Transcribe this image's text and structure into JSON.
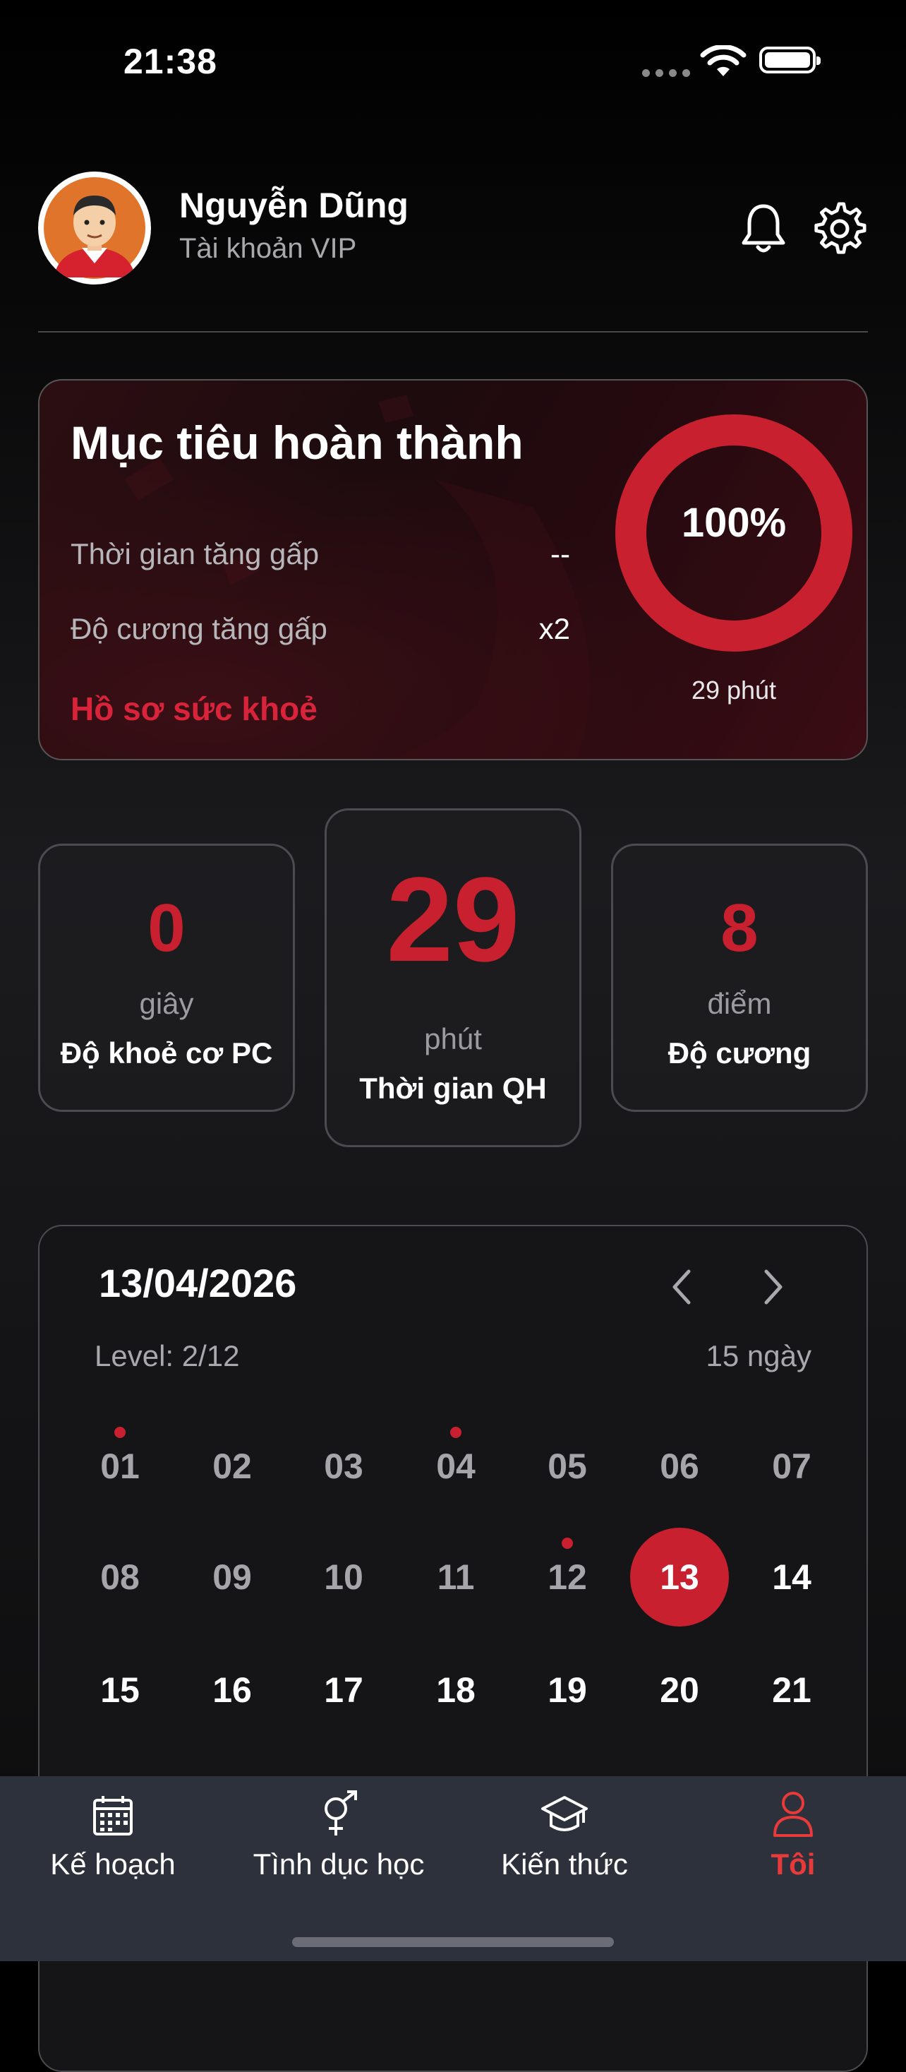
{
  "status_bar": {
    "time": "21:38"
  },
  "profile": {
    "name": "Nguyễn Dũng",
    "subtitle": "Tài khoản VIP",
    "avatar_icon": "avatar-icon",
    "bell_icon": "bell-icon",
    "settings_icon": "gear-icon"
  },
  "goal": {
    "title": "Mục tiêu hoàn thành",
    "rows": [
      {
        "label": "Thời gian tăng gấp",
        "value": "--"
      },
      {
        "label": "Độ cương tăng gấp",
        "value": "x2"
      }
    ],
    "link": "Hồ sơ sức khoẻ",
    "progress_label": "100%",
    "progress_value": 1.0,
    "progress_caption": "29 phút"
  },
  "stats": [
    {
      "value": "0",
      "unit": "giây",
      "label": "Độ khoẻ cơ PC"
    },
    {
      "value": "29",
      "unit": "phút",
      "label": "Thời gian QH"
    },
    {
      "value": "8",
      "unit": "điểm",
      "label": "Độ cương"
    }
  ],
  "calendar": {
    "date": "13/04/2026",
    "level": "Level: 2/12",
    "days_count": "15 ngày",
    "days": [
      {
        "label": "01",
        "state": "past",
        "dot": true
      },
      {
        "label": "02",
        "state": "past",
        "dot": false
      },
      {
        "label": "03",
        "state": "past",
        "dot": false
      },
      {
        "label": "04",
        "state": "past",
        "dot": true
      },
      {
        "label": "05",
        "state": "past",
        "dot": false
      },
      {
        "label": "06",
        "state": "past",
        "dot": false
      },
      {
        "label": "07",
        "state": "past",
        "dot": false
      },
      {
        "label": "08",
        "state": "past",
        "dot": false
      },
      {
        "label": "09",
        "state": "past",
        "dot": false
      },
      {
        "label": "10",
        "state": "past",
        "dot": false
      },
      {
        "label": "11",
        "state": "past",
        "dot": false
      },
      {
        "label": "12",
        "state": "past",
        "dot": true
      },
      {
        "label": "13",
        "state": "today",
        "dot": false
      },
      {
        "label": "14",
        "state": "future",
        "dot": false
      },
      {
        "label": "15",
        "state": "future",
        "dot": false
      },
      {
        "label": "16",
        "state": "future",
        "dot": false
      },
      {
        "label": "17",
        "state": "future",
        "dot": false
      },
      {
        "label": "18",
        "state": "future",
        "dot": false
      },
      {
        "label": "19",
        "state": "future",
        "dot": false
      },
      {
        "label": "20",
        "state": "future",
        "dot": false
      },
      {
        "label": "21",
        "state": "future",
        "dot": false
      }
    ]
  },
  "nav": [
    {
      "label": "Kế hoạch",
      "icon": "calendar-icon",
      "active": false
    },
    {
      "label": "Tình dục học",
      "icon": "gender-icon",
      "active": false
    },
    {
      "label": "Kiến thức",
      "icon": "graduation-cap-icon",
      "active": false
    },
    {
      "label": "Tôi",
      "icon": "user-icon",
      "active": true
    }
  ],
  "colors": {
    "accent": "#c8202f",
    "nav_active": "#e83a3a",
    "nav_bg": "#2d313c"
  }
}
